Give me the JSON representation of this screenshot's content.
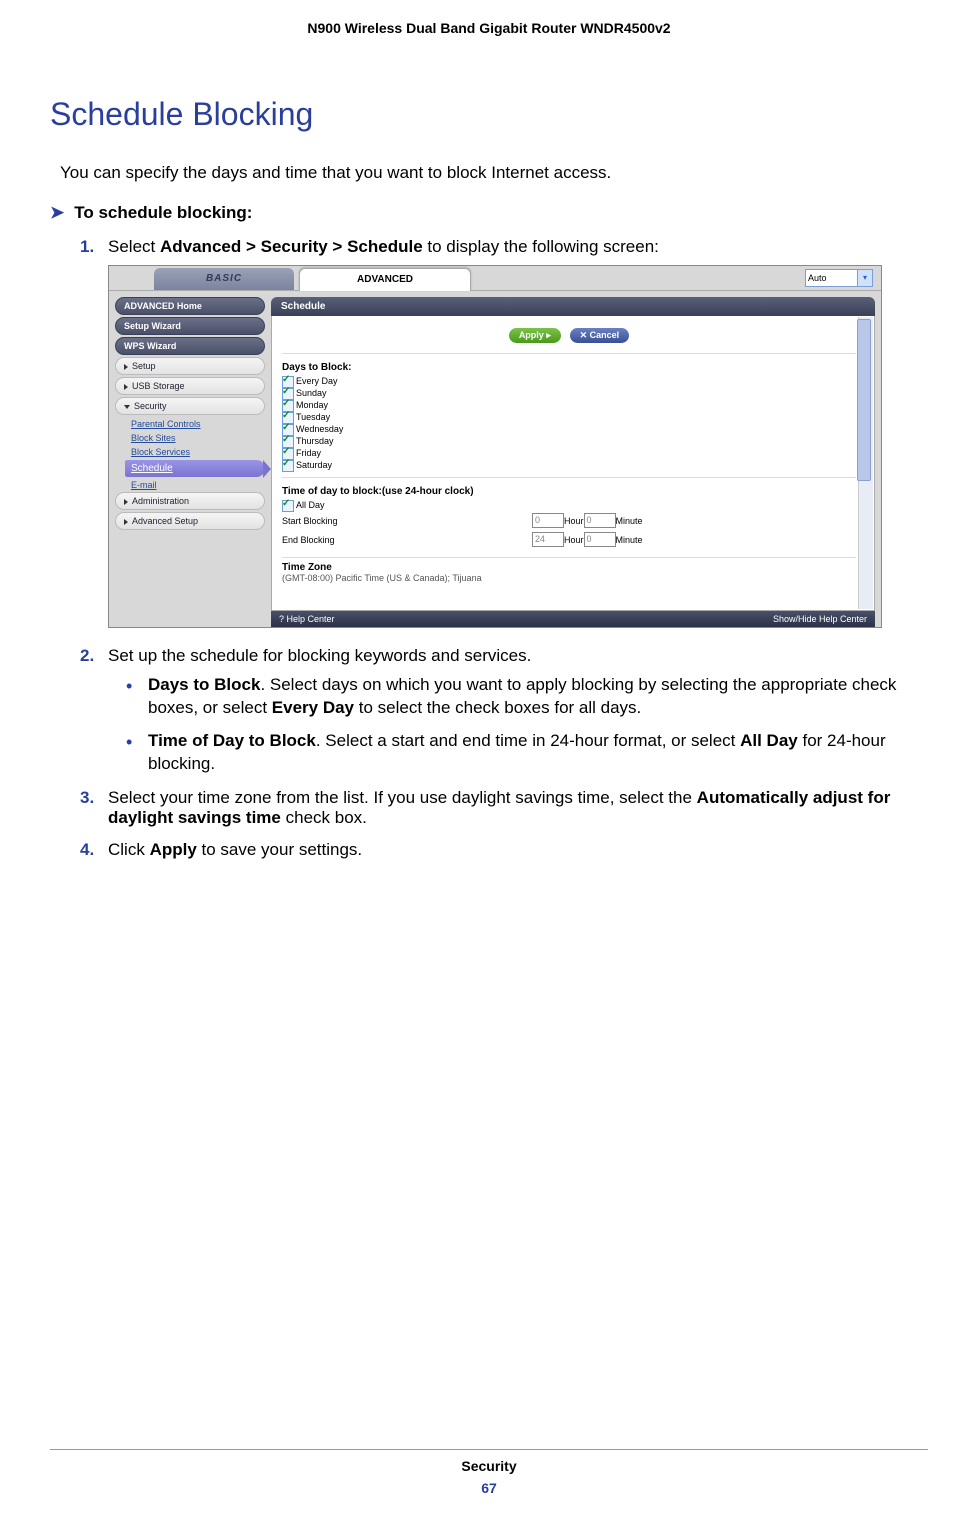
{
  "doc_header": "N900 Wireless Dual Band Gigabit Router WNDR4500v2",
  "heading": "Schedule Blocking",
  "intro": "You can specify the days and time that you want to block Internet access.",
  "proc_title": "To schedule blocking:",
  "step1_pre": "Select ",
  "step1_bold": "Advanced > Security > Schedule",
  "step1_post": " to display the following screen:",
  "step2": "Set up the schedule for blocking keywords and services.",
  "bullet_days_b": "Days to Block",
  "bullet_days_txt": ". Select days on which you want to apply blocking by selecting the appropriate check boxes, or select ",
  "bullet_days_b2": "Every Day",
  "bullet_days_post": " to select the check boxes for all days.",
  "bullet_time_b": "Time of Day to Block",
  "bullet_time_txt": ". Select a start and end time in 24-hour format, or select ",
  "bullet_time_b2": "All Day",
  "bullet_time_post": " for 24-hour blocking.",
  "step3_pre": "Select your time zone from the list. If you use daylight savings time, select the ",
  "step3_bold": "Automatically adjust for daylight savings time",
  "step3_post": " check box.",
  "step4_pre": "Click ",
  "step4_bold": "Apply",
  "step4_post": " to save your settings.",
  "footer_cat": "Security",
  "footer_num": "67",
  "ui": {
    "tab_basic": "BASIC",
    "tab_advanced": "ADVANCED",
    "auto": "Auto",
    "side": {
      "home": "ADVANCED Home",
      "setup_wiz": "Setup Wizard",
      "wps": "WPS Wizard",
      "setup": "Setup",
      "usb": "USB Storage",
      "security": "Security",
      "parental": "Parental Controls",
      "sites": "Block Sites",
      "services": "Block Services",
      "schedule": "Schedule",
      "email": "E-mail",
      "admin": "Administration",
      "advsetup": "Advanced Setup"
    },
    "panel_title": "Schedule",
    "apply": "Apply ▸",
    "cancel": "✕ Cancel",
    "days_label": "Days to Block:",
    "days": {
      "every": "Every Day",
      "sun": "Sunday",
      "mon": "Monday",
      "tue": "Tuesday",
      "wed": "Wednesday",
      "thu": "Thursday",
      "fri": "Friday",
      "sat": "Saturday"
    },
    "tod_label": "Time of day to block:(use 24-hour clock)",
    "allday": "All Day",
    "start": "Start Blocking",
    "end": "End Blocking",
    "hour": "Hour",
    "minute": "Minute",
    "start_h": "0",
    "start_m": "0",
    "end_h": "24",
    "end_m": "0",
    "tz_label": "Time Zone",
    "tz_value": "(GMT-08:00) Pacific Time (US & Canada); Tijuana",
    "help": "Help Center",
    "help_toggle": "Show/Hide Help Center"
  }
}
